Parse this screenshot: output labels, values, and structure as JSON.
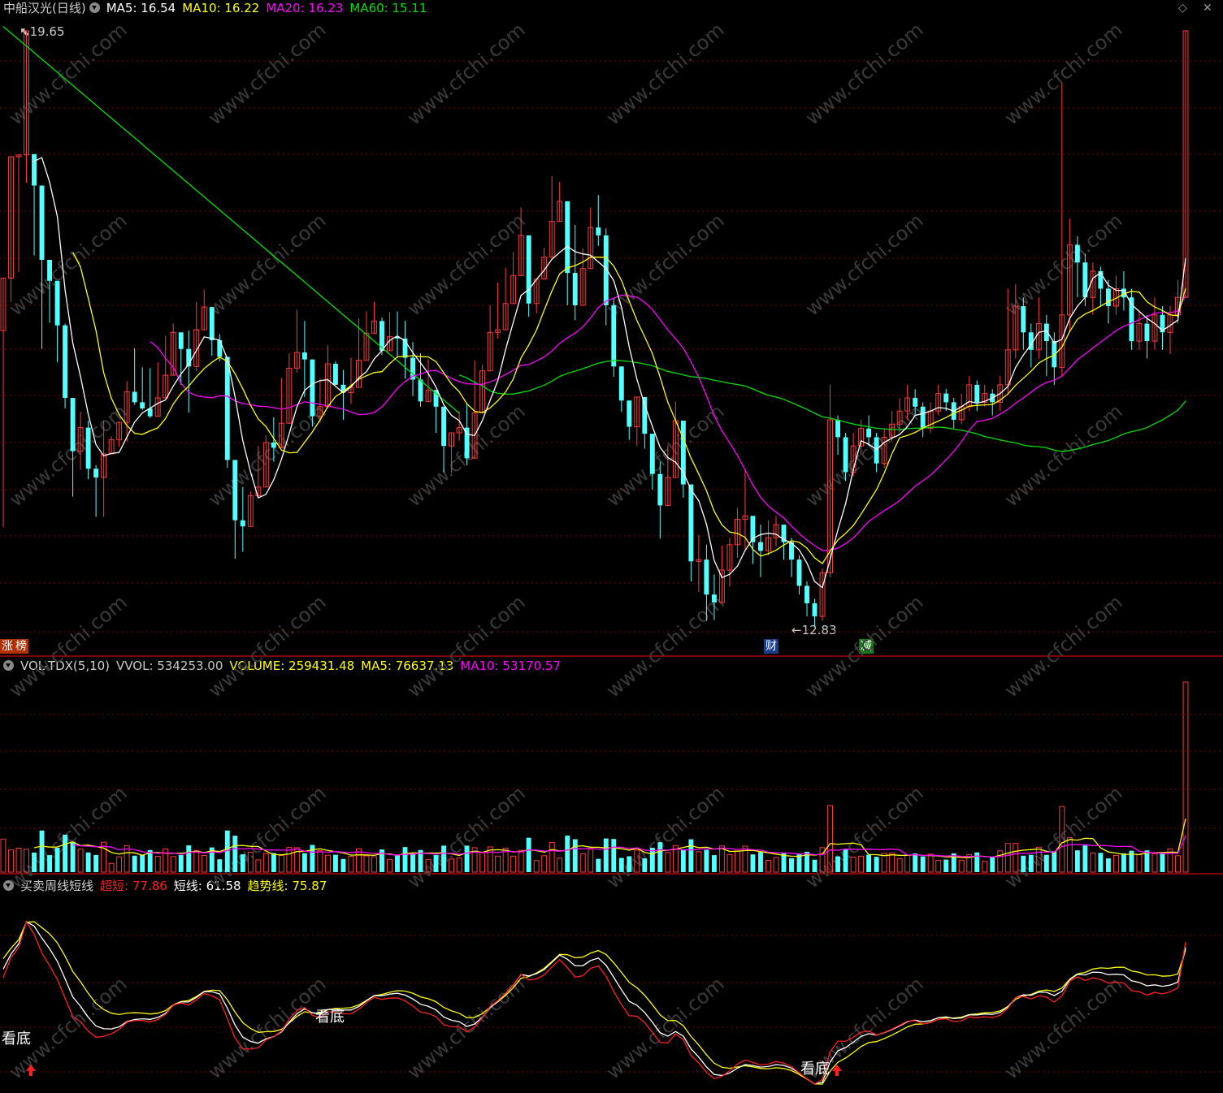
{
  "main_panel": {
    "title": "中船汉光(日线)",
    "ma_labels": [
      {
        "text": "MA5: 16.54",
        "color": "#ffffff"
      },
      {
        "text": "MA10: 16.22",
        "color": "#ffff00"
      },
      {
        "text": "MA20: 16.23",
        "color": "#ff00ff"
      },
      {
        "text": "MA60: 15.11",
        "color": "#00e000"
      }
    ],
    "high_label": "19.65",
    "low_label": "12.83",
    "tags": [
      "涨",
      "榜",
      "财",
      "减"
    ]
  },
  "vol_panel": {
    "title": "VOL-TDX(5,10)",
    "labels": [
      {
        "text": "VVOL: 534253.00",
        "color": "#c8c8c8"
      },
      {
        "text": "VOLUME: 259431.48",
        "color": "#ffff00"
      },
      {
        "text": "MA5: 76637.13",
        "color": "#ffff00"
      },
      {
        "text": "MA10: 53170.57",
        "color": "#ff00ff"
      }
    ]
  },
  "ind_panel": {
    "title": "买卖周线短线",
    "labels": [
      {
        "text": "超短: 77.86",
        "color": "#ff2020"
      },
      {
        "text": "短线: 61.58",
        "color": "#ffffff"
      },
      {
        "text": "趋势线: 75.87",
        "color": "#ffff00"
      }
    ],
    "signal_text": "看底"
  },
  "watermark": "www.cfchi.com",
  "colors": {
    "up": "#ff3b3b",
    "down": "#54ffff",
    "ma5": "#ffffff",
    "ma10": "#ffff00",
    "ma20": "#ff00ff",
    "ma60": "#00e000",
    "grid": "#7a0000",
    "border": "#b00000"
  },
  "chart_data": {
    "type": "candlestick",
    "y_range": [
      12.5,
      20.0
    ],
    "candles": [
      [
        16.22,
        16.82,
        15.5,
        13.97
      ],
      [
        16.82,
        18.21,
        16.23,
        16.55
      ],
      [
        18.21,
        18.23,
        17.8,
        16.89
      ],
      [
        18.23,
        19.65,
        17.8,
        17.91
      ],
      [
        18.24,
        17.88,
        17.52,
        17.08
      ],
      [
        17.88,
        17.03,
        17.33,
        16.01
      ],
      [
        17.03,
        16.79,
        16.88,
        16.31
      ],
      [
        16.79,
        16.28,
        16.44,
        15.86
      ],
      [
        16.28,
        15.45,
        16.3,
        15.33
      ],
      [
        15.45,
        14.84,
        15.45,
        14.32
      ],
      [
        14.84,
        15.11,
        15.29,
        14.63
      ],
      [
        15.11,
        14.64,
        15.19,
        14.52
      ],
      [
        14.64,
        14.54,
        14.68,
        14.09
      ],
      [
        14.54,
        14.81,
        15.19,
        14.09
      ],
      [
        14.81,
        14.97,
        15.01,
        14.91
      ],
      [
        14.97,
        15.17,
        15.18,
        14.89
      ],
      [
        15.17,
        15.52,
        15.64,
        14.95
      ],
      [
        15.52,
        15.4,
        16.02,
        15.37
      ],
      [
        15.4,
        15.33,
        15.8,
        15.31
      ],
      [
        15.33,
        15.24,
        15.79,
        15.22
      ],
      [
        15.24,
        15.45,
        15.86,
        15.41
      ],
      [
        15.45,
        15.71,
        16.16,
        15.48
      ],
      [
        15.71,
        16.2,
        16.3,
        15.95
      ],
      [
        16.2,
        16.01,
        16.09,
        15.6
      ],
      [
        16.01,
        15.81,
        16.22,
        15.28
      ],
      [
        15.81,
        16.23,
        16.55,
        15.75
      ],
      [
        16.23,
        16.49,
        16.69,
        16.36
      ],
      [
        16.49,
        16.11,
        16.47,
        15.93
      ],
      [
        16.11,
        15.92,
        16.18,
        15.87
      ],
      [
        15.92,
        14.74,
        15.84,
        14.65
      ],
      [
        14.74,
        14.05,
        14.64,
        13.61
      ],
      [
        14.05,
        13.98,
        14.43,
        13.69
      ],
      [
        13.98,
        14.33,
        14.38,
        14.03
      ],
      [
        14.33,
        14.43,
        14.9,
        14.41
      ],
      [
        14.43,
        14.94,
        15.02,
        14.74
      ],
      [
        14.94,
        14.88,
        15.23,
        14.72
      ],
      [
        14.88,
        15.16,
        15.68,
        15.11
      ],
      [
        15.16,
        15.79,
        15.96,
        15.41
      ],
      [
        15.79,
        15.97,
        16.46,
        15.74
      ],
      [
        15.97,
        15.89,
        16.33,
        15.46
      ],
      [
        15.89,
        15.24,
        15.77,
        15.12
      ],
      [
        15.24,
        15.35,
        15.67,
        15.17
      ],
      [
        15.35,
        15.84,
        16.05,
        15.8
      ],
      [
        15.84,
        15.6,
        15.87,
        15.6
      ],
      [
        15.6,
        15.51,
        15.77,
        15.2
      ],
      [
        15.51,
        15.57,
        15.91,
        15.38
      ],
      [
        15.57,
        15.88,
        16.36,
        15.79
      ],
      [
        15.88,
        16.19,
        16.44,
        15.93
      ],
      [
        16.19,
        16.33,
        16.55,
        16.2
      ],
      [
        16.33,
        15.99,
        16.37,
        15.94
      ],
      [
        15.99,
        16.15,
        16.43,
        16.1
      ],
      [
        16.15,
        16.13,
        16.44,
        15.91
      ],
      [
        16.13,
        15.91,
        16.33,
        15.67
      ],
      [
        15.91,
        15.66,
        16.09,
        15.47
      ],
      [
        15.66,
        15.41,
        15.96,
        15.35
      ],
      [
        15.41,
        15.54,
        15.89,
        15.4
      ],
      [
        15.54,
        15.35,
        15.54,
        15.05
      ],
      [
        15.35,
        14.9,
        15.27,
        14.6
      ],
      [
        14.9,
        15.05,
        15.03,
        14.59
      ],
      [
        15.05,
        15.11,
        15.3,
        14.96
      ],
      [
        15.11,
        14.76,
        15.38,
        14.68
      ],
      [
        14.76,
        15.28,
        15.88,
        15.04
      ],
      [
        15.28,
        15.76,
        15.83,
        15.54
      ],
      [
        15.76,
        16.2,
        16.51,
        16.06
      ],
      [
        16.2,
        16.23,
        16.77,
        16.13
      ],
      [
        16.23,
        16.53,
        16.94,
        16.24
      ],
      [
        16.53,
        16.85,
        17.12,
        16.57
      ],
      [
        16.85,
        17.31,
        17.63,
        17.06
      ],
      [
        17.31,
        16.53,
        17.3,
        16.38
      ],
      [
        16.53,
        16.81,
        16.61,
        16.42
      ],
      [
        16.81,
        17.06,
        17.17,
        16.85
      ],
      [
        17.06,
        17.47,
        17.99,
        17.11
      ],
      [
        17.47,
        17.7,
        17.92,
        17.56
      ],
      [
        17.7,
        16.88,
        17.68,
        16.51
      ],
      [
        16.88,
        16.51,
        17.43,
        16.34
      ],
      [
        16.51,
        16.93,
        17.16,
        16.73
      ],
      [
        16.93,
        17.4,
        17.63,
        17.18
      ],
      [
        17.4,
        17.31,
        17.77,
        17.19
      ],
      [
        17.31,
        16.51,
        17.39,
        16.28
      ],
      [
        16.51,
        15.81,
        16.6,
        15.69
      ],
      [
        15.81,
        15.42,
        15.57,
        15.29
      ],
      [
        15.42,
        15.12,
        15.2,
        14.97
      ],
      [
        15.12,
        15.46,
        15.28,
        14.9
      ],
      [
        15.46,
        15.04,
        15.02,
        14.87
      ],
      [
        15.04,
        14.58,
        15.03,
        14.4
      ],
      [
        14.58,
        14.22,
        14.72,
        13.84
      ],
      [
        14.22,
        14.54,
        14.91,
        14.28
      ],
      [
        14.54,
        15.19,
        15.41,
        14.87
      ],
      [
        15.19,
        14.46,
        14.94,
        14.31
      ],
      [
        14.46,
        13.58,
        14.32,
        13.35
      ],
      [
        13.58,
        13.6,
        13.88,
        13.23
      ],
      [
        13.6,
        13.2,
        13.77,
        12.9
      ],
      [
        13.2,
        13.11,
        13.43,
        12.91
      ],
      [
        13.11,
        13.48,
        13.76,
        13.1
      ],
      [
        13.48,
        13.77,
        13.85,
        13.29
      ],
      [
        13.77,
        14.06,
        14.19,
        13.62
      ],
      [
        14.06,
        14.1,
        14.63,
        13.72
      ],
      [
        14.1,
        13.8,
        14.05,
        13.55
      ],
      [
        13.8,
        13.7,
        14.0,
        13.4
      ],
      [
        13.7,
        13.85,
        14.05,
        13.65
      ],
      [
        13.85,
        14.0,
        14.1,
        13.75
      ],
      [
        14.0,
        13.8,
        14.0,
        13.6
      ],
      [
        13.8,
        13.6,
        13.85,
        13.4
      ],
      [
        13.6,
        13.3,
        13.65,
        13.2
      ],
      [
        13.3,
        13.1,
        13.35,
        12.95
      ],
      [
        13.1,
        12.95,
        13.15,
        12.83
      ],
      [
        12.95,
        13.45,
        13.5,
        12.9
      ],
      [
        13.45,
        15.2,
        15.6,
        13.4
      ],
      [
        15.2,
        15.0,
        15.25,
        14.8
      ],
      [
        15.0,
        14.6,
        15.05,
        14.5
      ],
      [
        14.6,
        14.9,
        15.05,
        14.55
      ],
      [
        14.9,
        15.1,
        15.2,
        14.8
      ],
      [
        15.1,
        15.0,
        15.25,
        14.9
      ],
      [
        15.0,
        14.7,
        15.05,
        14.6
      ],
      [
        14.7,
        15.0,
        15.1,
        14.65
      ],
      [
        15.0,
        15.15,
        15.3,
        14.95
      ],
      [
        15.15,
        15.3,
        15.45,
        15.05
      ],
      [
        15.3,
        15.45,
        15.6,
        15.2
      ],
      [
        15.45,
        15.35,
        15.55,
        15.25
      ],
      [
        15.35,
        15.1,
        15.4,
        15.0
      ],
      [
        15.1,
        15.3,
        15.4,
        15.05
      ],
      [
        15.3,
        15.5,
        15.6,
        15.25
      ],
      [
        15.5,
        15.4,
        15.55,
        15.3
      ],
      [
        15.4,
        15.2,
        15.45,
        15.1
      ],
      [
        15.2,
        15.35,
        15.5,
        15.15
      ],
      [
        15.35,
        15.6,
        15.7,
        15.3
      ],
      [
        15.6,
        15.4,
        15.65,
        15.3
      ],
      [
        15.4,
        15.5,
        15.6,
        15.35
      ],
      [
        15.5,
        15.4,
        15.55,
        15.25
      ],
      [
        15.4,
        15.6,
        15.7,
        15.3
      ],
      [
        15.6,
        16.0,
        16.7,
        15.5
      ],
      [
        16.0,
        16.5,
        16.75,
        15.9
      ],
      [
        16.5,
        16.2,
        16.6,
        16.0
      ],
      [
        16.2,
        16.0,
        16.3,
        15.8
      ],
      [
        16.0,
        16.3,
        16.6,
        15.9
      ],
      [
        16.3,
        16.1,
        16.4,
        15.7
      ],
      [
        16.1,
        15.8,
        16.2,
        15.6
      ],
      [
        15.8,
        16.4,
        19.05,
        15.7
      ],
      [
        16.4,
        17.2,
        17.5,
        16.2
      ],
      [
        17.2,
        17.0,
        17.3,
        16.6
      ],
      [
        17.0,
        16.6,
        17.1,
        16.5
      ],
      [
        16.6,
        16.9,
        17.0,
        16.4
      ],
      [
        16.9,
        16.7,
        16.95,
        16.5
      ],
      [
        16.7,
        16.5,
        16.8,
        16.3
      ],
      [
        16.5,
        16.7,
        16.85,
        16.4
      ],
      [
        16.7,
        16.6,
        16.9,
        16.45
      ],
      [
        16.6,
        16.1,
        16.7,
        16.0
      ],
      [
        16.1,
        16.3,
        16.45,
        16.0
      ],
      [
        16.3,
        16.1,
        16.4,
        15.9
      ],
      [
        16.1,
        16.4,
        16.6,
        16.0
      ],
      [
        16.4,
        16.2,
        16.5,
        16.0
      ],
      [
        16.2,
        16.4,
        16.5,
        15.95
      ],
      [
        16.4,
        16.6,
        16.8,
        16.3
      ],
      [
        16.6,
        19.65,
        19.65,
        16.6
      ]
    ],
    "volume": [],
    "indicator": {
      "series": [
        "超短",
        "短线",
        "趋势线"
      ]
    }
  }
}
